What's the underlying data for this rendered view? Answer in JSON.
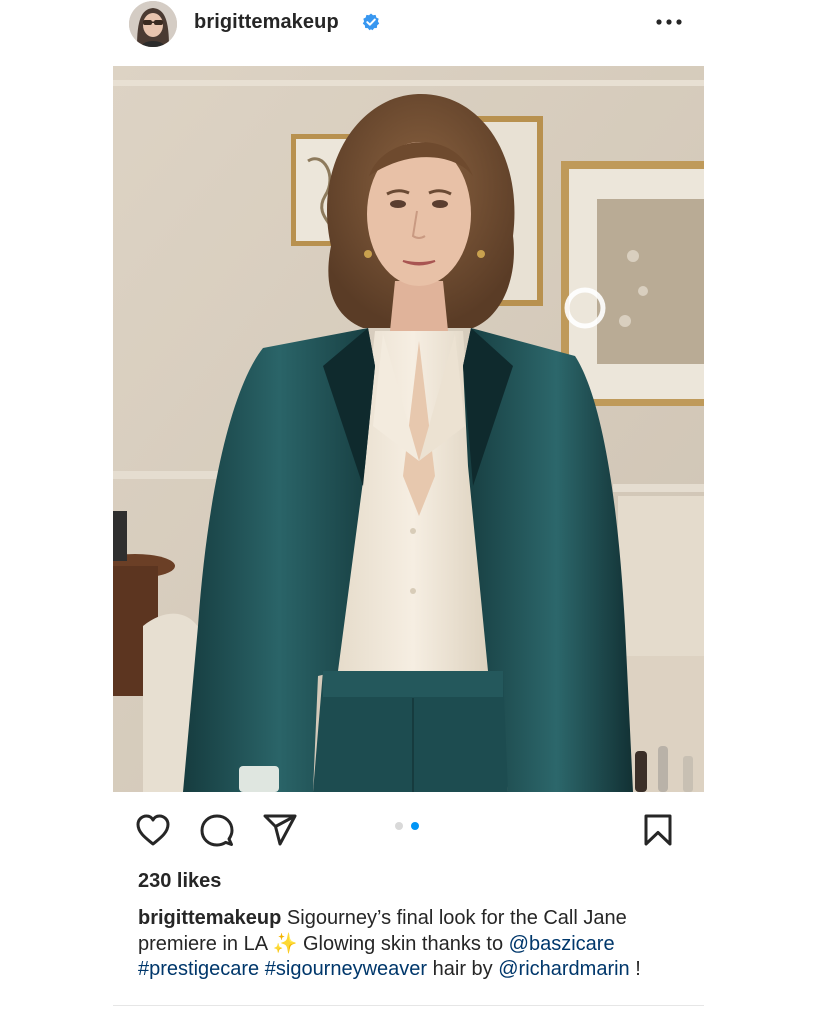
{
  "post": {
    "username": "brigittemakeup",
    "verified": true,
    "more_icon": "more-horizontal-icon",
    "carousel": {
      "count": 2,
      "active_index": 1
    },
    "likes": "230 likes",
    "caption": {
      "username": "brigittemakeup",
      "part1": "Sigourney’s final look for the Call Jane premiere in LA",
      "emoji": "✨",
      "part2": "Glowing skin thanks to",
      "mention1": "@baszicare",
      "tag1": "#prestigecare",
      "tag2": "#sigourneyweaver",
      "part3": "hair by",
      "mention2": "@richardmarin",
      "end": "!"
    }
  },
  "icons": {
    "like": "heart-icon",
    "comment": "comment-icon",
    "share": "send-icon",
    "save": "bookmark-icon"
  },
  "colors": {
    "verified_badge": "#3897f0",
    "active_dot": "#0095f6",
    "inactive_dot": "#d9d9d9",
    "link": "#00376b",
    "text": "#262626",
    "jacket": "#1f4f52",
    "blouse": "#efe6d6"
  }
}
